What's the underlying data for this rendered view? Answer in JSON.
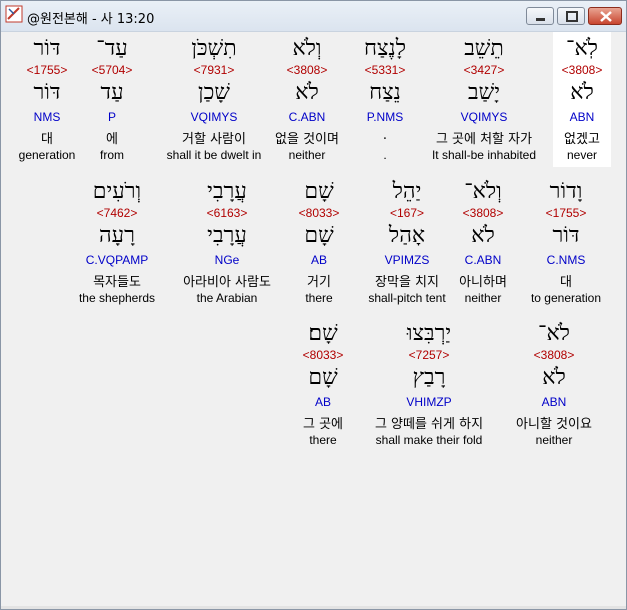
{
  "window": {
    "title": "@원전본해 - 사 13:20"
  },
  "rows": [
    [
      {
        "hebrew": "לֹֽא־",
        "strong": "<3808>",
        "lemma": "לֹא",
        "morph": "ABN",
        "korean": "없겠고",
        "english": "never"
      },
      {
        "hebrew": "תֵשֵׁב",
        "strong": "<3427>",
        "lemma": "יָשַׁב",
        "morph": "VQIMYS",
        "korean": "그 곳에 처할 자가",
        "english": "It shall-be inhabited"
      },
      {
        "hebrew": "לָנֶצַח",
        "strong": "<5331>",
        "lemma": "נֵצַח",
        "morph": "P.NMS",
        "korean": ".",
        "english": "."
      },
      {
        "hebrew": "וְלֹא",
        "strong": "<3808>",
        "lemma": "לֹא",
        "morph": "C.ABN",
        "korean": "없을 것이며",
        "english": "neither"
      },
      {
        "hebrew": "תִשְׁכֹּן",
        "strong": "<7931>",
        "lemma": "שָׁכַן",
        "morph": "VQIMYS",
        "korean": "거할 사람이",
        "english": "shall it be dwelt in"
      },
      {
        "hebrew": "עַד־",
        "strong": "<5704>",
        "lemma": "עַד",
        "morph": "P",
        "korean": "에",
        "english": "from"
      },
      {
        "hebrew": "דּוֹר",
        "strong": "<1755>",
        "lemma": "דּוֹר",
        "morph": "NMS",
        "korean": "대",
        "english": "generation"
      }
    ],
    [
      {
        "hebrew": "וָדוֹר",
        "strong": "<1755>",
        "lemma": "דּוֹר",
        "morph": "C.NMS",
        "korean": "대",
        "english": "to generation"
      },
      {
        "hebrew": "וְלֹא־",
        "strong": "<3808>",
        "lemma": "לֹא",
        "morph": "C.ABN",
        "korean": "아니하며",
        "english": "neither"
      },
      {
        "hebrew": "יַהֵל",
        "strong": "<167>",
        "lemma": "אָהַל",
        "morph": "VPIMZS",
        "korean": "장막을 치지",
        "english": "shall-pitch tent"
      },
      {
        "hebrew": "שָׁם",
        "strong": "<8033>",
        "lemma": "שָׁם",
        "morph": "AB",
        "korean": "거기",
        "english": "there"
      },
      {
        "hebrew": "עֲרָבִי",
        "strong": "<6163>",
        "lemma": "עֲרָבִי",
        "morph": "NGe",
        "korean": "아라비아 사람도",
        "english": "the Arabian"
      },
      {
        "hebrew": "וְרֹעִים",
        "strong": "<7462>",
        "lemma": "רָעָה",
        "morph": "C.VQPAMP",
        "korean": "목자들도",
        "english": "the shepherds"
      }
    ],
    [
      {
        "hebrew": "לֹא־",
        "strong": "<3808>",
        "lemma": "לֹא",
        "morph": "ABN",
        "korean": "아니할 것이요",
        "english": "neither"
      },
      {
        "hebrew": "יַרְבִּצוּ",
        "strong": "<7257>",
        "lemma": "רָבַץ",
        "morph": "VHIMZP",
        "korean": "그 양떼를 쉬게 하지",
        "english": "shall make their fold"
      },
      {
        "hebrew": "שָׁם׃",
        "strong": "<8033>",
        "lemma": "שָׁם",
        "morph": "AB",
        "korean": "그 곳에",
        "english": "there"
      }
    ]
  ]
}
